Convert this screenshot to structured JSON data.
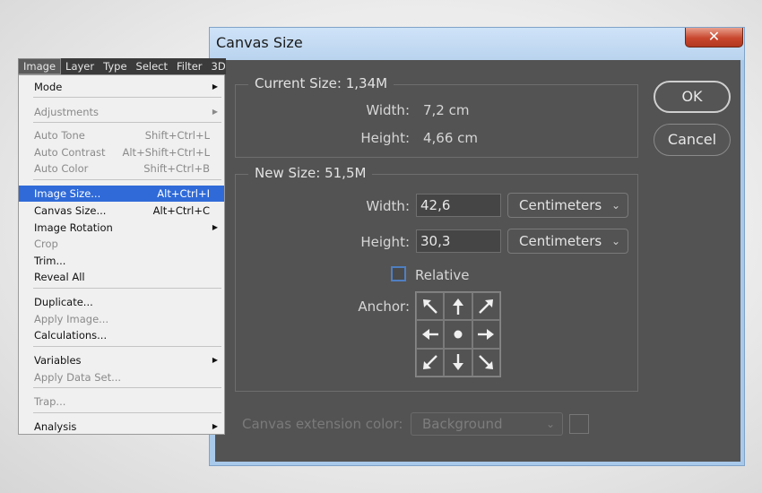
{
  "dialog": {
    "title": "Canvas Size",
    "close_glyph": "✕",
    "ok_label": "OK",
    "cancel_label": "Cancel",
    "current": {
      "label": "Current Size: 1,34M",
      "width_label": "Width:",
      "width_value": "7,2 cm",
      "height_label": "Height:",
      "height_value": "4,66 cm"
    },
    "new_size": {
      "label": "New Size: 51,5M",
      "width_label": "Width:",
      "width_value": "42,6",
      "width_unit": "Centimeters",
      "height_label": "Height:",
      "height_value": "30,3",
      "height_unit": "Centimeters",
      "relative_label": "Relative",
      "relative_checked": false,
      "anchor_label": "Anchor:",
      "anchor_cells": [
        "arrow-up-left",
        "arrow-up",
        "arrow-up-right",
        "arrow-left",
        "center-dot",
        "arrow-right",
        "arrow-down-left",
        "arrow-down",
        "arrow-down-right"
      ]
    },
    "extension": {
      "label": "Canvas extension color:",
      "value": "Background"
    }
  },
  "menubar": {
    "items": [
      "Image",
      "Layer",
      "Type",
      "Select",
      "Filter",
      "3D"
    ]
  },
  "menu": {
    "items": [
      {
        "label": "Mode",
        "shortcut": "",
        "submenu": true,
        "disabled": false
      },
      {
        "label": "Adjustments",
        "shortcut": "",
        "submenu": true,
        "disabled": true
      },
      {
        "label": "Auto Tone",
        "shortcut": "Shift+Ctrl+L",
        "submenu": false,
        "disabled": true
      },
      {
        "label": "Auto Contrast",
        "shortcut": "Alt+Shift+Ctrl+L",
        "submenu": false,
        "disabled": true
      },
      {
        "label": "Auto Color",
        "shortcut": "Shift+Ctrl+B",
        "submenu": false,
        "disabled": true
      },
      {
        "label": "Image Size...",
        "shortcut": "Alt+Ctrl+I",
        "submenu": false,
        "disabled": false,
        "highlighted": true
      },
      {
        "label": "Canvas Size...",
        "shortcut": "Alt+Ctrl+C",
        "submenu": false,
        "disabled": false
      },
      {
        "label": "Image Rotation",
        "shortcut": "",
        "submenu": true,
        "disabled": false
      },
      {
        "label": "Crop",
        "shortcut": "",
        "submenu": false,
        "disabled": true
      },
      {
        "label": "Trim...",
        "shortcut": "",
        "submenu": false,
        "disabled": false
      },
      {
        "label": "Reveal All",
        "shortcut": "",
        "submenu": false,
        "disabled": false
      },
      {
        "label": "Duplicate...",
        "shortcut": "",
        "submenu": false,
        "disabled": false
      },
      {
        "label": "Apply Image...",
        "shortcut": "",
        "submenu": false,
        "disabled": true
      },
      {
        "label": "Calculations...",
        "shortcut": "",
        "submenu": false,
        "disabled": false
      },
      {
        "label": "Variables",
        "shortcut": "",
        "submenu": true,
        "disabled": false
      },
      {
        "label": "Apply Data Set...",
        "shortcut": "",
        "submenu": false,
        "disabled": true
      },
      {
        "label": "Trap...",
        "shortcut": "",
        "submenu": false,
        "disabled": true
      },
      {
        "label": "Analysis",
        "shortcut": "",
        "submenu": true,
        "disabled": false
      }
    ]
  },
  "colors": {
    "dialog_bg": "#535353",
    "highlight": "#2f6ad8",
    "title_bar": "#b9d3ee",
    "close_button": "#c8472e"
  }
}
